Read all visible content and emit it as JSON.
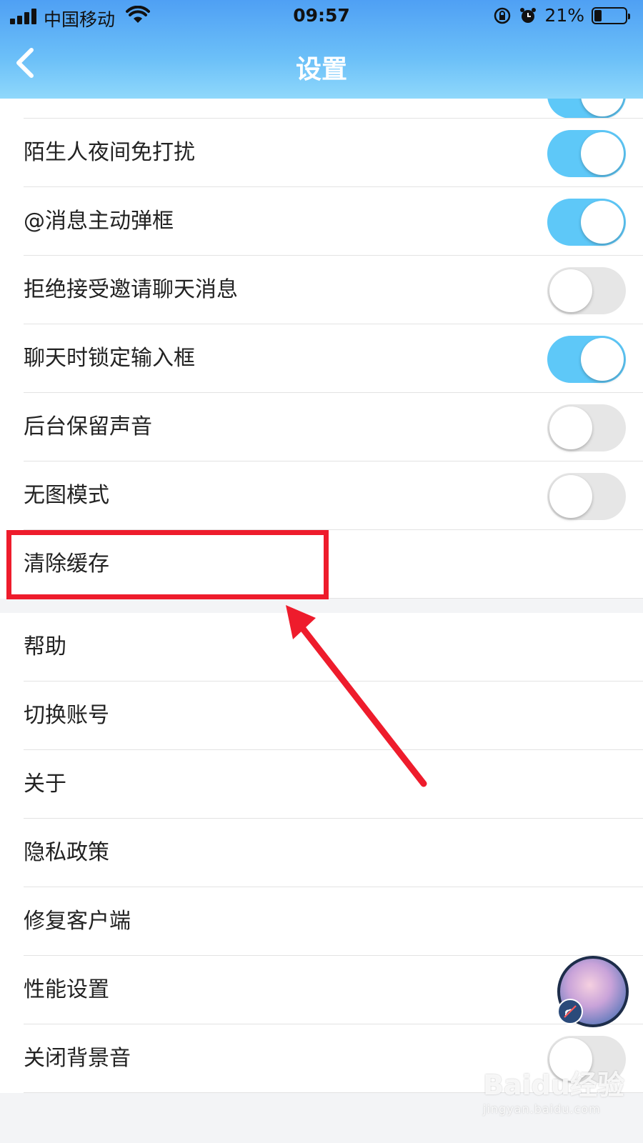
{
  "status_bar": {
    "carrier": "中国移动",
    "time": "09:57",
    "battery_percent": "21%",
    "battery_level": 0.21
  },
  "nav": {
    "title": "设置",
    "back_icon": "chevron-left-icon"
  },
  "colors": {
    "header_top": "#4fa0f4",
    "header_bottom": "#8fd8fb",
    "toggle_on": "#5ec8f8",
    "toggle_off": "#e6e6e6",
    "highlight": "#ee1c2c"
  },
  "settings_group1": [
    {
      "label": "陌生人夜间免打扰",
      "toggle": true
    },
    {
      "label": "@消息主动弹框",
      "toggle": true
    },
    {
      "label": "拒绝接受邀请聊天消息",
      "toggle": false
    },
    {
      "label": "聊天时锁定输入框",
      "toggle": true
    },
    {
      "label": "后台保留声音",
      "toggle": false
    },
    {
      "label": "无图模式",
      "toggle": false
    },
    {
      "label": "清除缓存"
    }
  ],
  "settings_group2": [
    {
      "label": "帮助"
    },
    {
      "label": "切换账号"
    },
    {
      "label": "关于"
    },
    {
      "label": "隐私政策"
    },
    {
      "label": "修复客户端"
    },
    {
      "label": "性能设置"
    },
    {
      "label": "关闭背景音",
      "toggle": false
    }
  ],
  "watermark": {
    "brand": "Baidu经验",
    "url": "jingyan.baidu.com"
  }
}
